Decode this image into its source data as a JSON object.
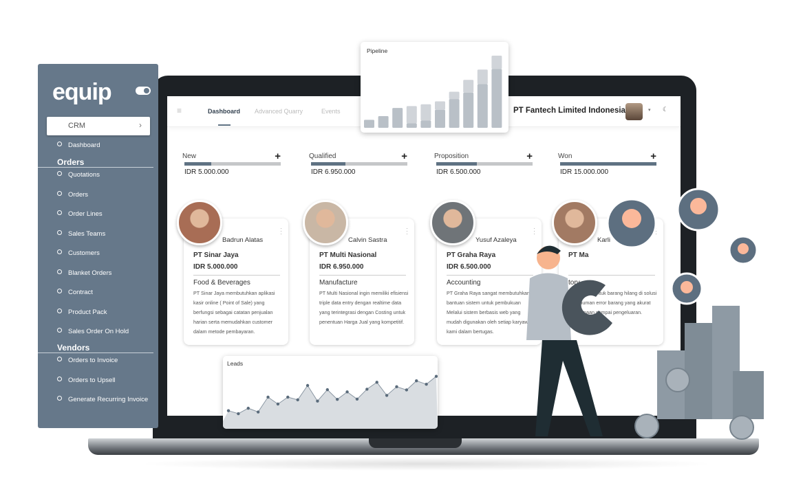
{
  "sidebar": {
    "logo": "equip",
    "module": "CRM",
    "items_top": [
      {
        "label": "Dashboard"
      }
    ],
    "sections": [
      {
        "title": "Orders",
        "items": [
          "Quotations",
          "Orders",
          "Order Lines",
          "Sales Teams",
          "Customers",
          "Blanket Orders",
          "Contract",
          "Product Pack",
          "Sales Order  On Hold"
        ]
      },
      {
        "title": "Vendors",
        "items": [
          "Orders to Invoice",
          "Orders to Upsell",
          "Generate Recurring Invoice"
        ]
      }
    ]
  },
  "header": {
    "tabs": [
      "Dashboard",
      "Advanced Quarry",
      "Events"
    ],
    "active_tab": "Dashboard",
    "company": "PT Fantech Limited Indonesia"
  },
  "stages": [
    {
      "label": "New",
      "amount": "IDR 5.000.000",
      "progress": 0.28
    },
    {
      "label": "Qualified",
      "amount": "IDR 6.950.000",
      "progress": 0.36
    },
    {
      "label": "Proposition",
      "amount": "IDR 6.500.000",
      "progress": 0.42
    },
    {
      "label": "Won",
      "amount": "IDR 15.000.000",
      "progress": 1.0
    }
  ],
  "cards": [
    {
      "name": "Badrun Alatas",
      "company": "PT Sinar Jaya",
      "amount": "IDR 5.000.000",
      "category": "Food & Beverages",
      "desc": "PT Sinar Jaya membutuhkan aplikasi kasir online ( Point of Sale) yang berfungsi sebagai catatan penjualan harian serta memudahkan customer dalam metode pembayaran."
    },
    {
      "name": "Calvin Sastra",
      "company": "PT Multi Nasional",
      "amount": "IDR 6.950.000",
      "category": "Manufacture",
      "desc": "PT Multi Nasional ingin memiliki efisiensi triple data entry dengan realtime data yang terintegrasi dengan Costing untuk penentuan Harga Jual yang kompetitif."
    },
    {
      "name": "Yusuf Azaleya",
      "company": "PT Graha Raya",
      "amount": "IDR 6.500.000",
      "category": "Accounting",
      "desc": "PT Graha Raya sangat membutuhkan bantuan sistem untuk pembukuan Melalui sistem berbasis web yang mudah digunakan oleh setiap karyawan kami dalam bertugas."
    },
    {
      "name": "Karli",
      "company": "PT Ma",
      "amount": "",
      "category": "tory",
      "desc": "masalahan untuk barang hilang di solusi agar human error barang yang akurat penerimaan sampai pengeluaran."
    }
  ],
  "pipeline": {
    "title": "Pipeline",
    "bottom": [
      35,
      51,
      87,
      20,
      32,
      79,
      126,
      154,
      191,
      258
    ],
    "top": [
      0,
      0,
      0,
      75,
      71,
      37,
      32,
      56,
      64,
      58
    ],
    "colors": {
      "dark": "#b9c0c7",
      "light": "#d0d4d9"
    }
  },
  "leads": {
    "title": "Leads",
    "values": [
      7.3,
      6.1,
      8.3,
      6.8,
      12.8,
      10,
      12.8,
      11.7,
      17.5,
      11.2,
      15.8,
      11.9,
      14.9,
      12,
      16,
      18.8,
      13.5,
      17,
      15.7,
      19.4,
      18,
      21.2
    ],
    "colors": {
      "fill": "#d9dde1",
      "line": "#8a96a2",
      "dot": "#5a6b7b"
    }
  },
  "colors": {
    "sidebar": "#66788a",
    "accent": "#5f7283"
  }
}
